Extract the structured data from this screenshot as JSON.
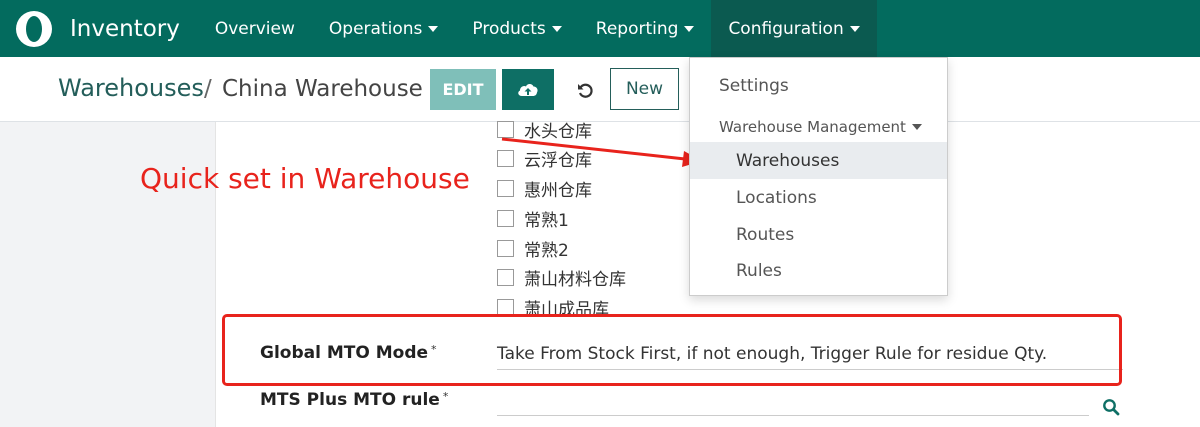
{
  "navbar": {
    "app_name": "Inventory",
    "items": [
      {
        "label": "Overview"
      },
      {
        "label": "Operations"
      },
      {
        "label": "Products"
      },
      {
        "label": "Reporting"
      },
      {
        "label": "Configuration"
      }
    ]
  },
  "breadcrumb": {
    "parent": "Warehouses",
    "separator": "/",
    "current": "China Warehouse"
  },
  "buttons": {
    "edit": "EDIT",
    "new": "New"
  },
  "warehouses": [
    "水头仓库",
    "云浮仓库",
    "惠州仓库",
    "常熟1",
    "常熟2",
    "萧山材料仓库",
    "萧山成品库"
  ],
  "annotation": "Quick set in Warehouse",
  "fields": {
    "global_mto_mode": {
      "label": "Global MTO Mode",
      "required_mark": "*",
      "value": "Take From Stock First, if not enough, Trigger Rule for residue Qty."
    },
    "mts_mto_rule": {
      "label": "MTS Plus MTO rule",
      "required_mark": "*",
      "value": ""
    }
  },
  "dropdown": {
    "settings": "Settings",
    "section_header": "Warehouse Management",
    "items": [
      "Warehouses",
      "Locations",
      "Routes",
      "Rules"
    ]
  },
  "colors": {
    "navbar": "#036b5e",
    "accent": "#245e5a",
    "annotation_red": "#e8231c"
  },
  "icons": [
    "app-logo-icon",
    "cloud-upload-icon",
    "undo-icon",
    "search-icon",
    "caret-down-icon"
  ]
}
